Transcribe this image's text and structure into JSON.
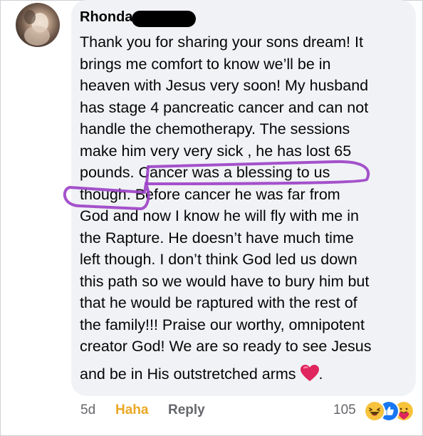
{
  "comment": {
    "author": "Rhonda",
    "lines": [
      "Thank you for sharing your sons dream!  It",
      "brings me comfort to know we’ll be in",
      "heaven with Jesus very soon!  My husband",
      "has stage 4 pancreatic cancer and can not",
      "handle the chemotherapy.  The sessions",
      "make him very very sick , he has lost 65",
      "pounds.  Cancer was a blessing to us",
      "though.  Before cancer he was far from",
      "God and now I know he will fly with me in",
      "the Rapture.  He doesn’t have much time",
      "left though.   I don’t think God led us down",
      "this path so we would have to bury him but",
      "that he would be raptured with the rest of",
      "the family!!!  Praise our worthy, omnipotent",
      "creator God!  We are so ready to see Jesus"
    ],
    "last_line": "and be in His outstretched arms",
    "last_line_end": ".",
    "highlight_color": "#9b3fc7"
  },
  "meta": {
    "time": "5d",
    "reaction_action": "Haha",
    "reply_label": "Reply",
    "reaction_count": "105",
    "reaction_icons": [
      "haha-icon",
      "like-icon",
      "care-icon"
    ]
  },
  "colors": {
    "bubble": "#f0f2f5",
    "meta_text": "#65676b",
    "haha_active": "#eaa823",
    "like_blue": "#1877f2",
    "heart_red": "#e0245e"
  }
}
